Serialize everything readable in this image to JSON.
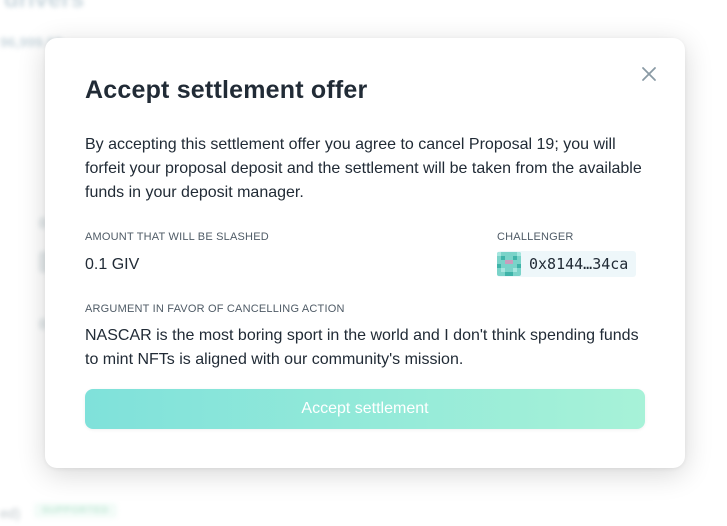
{
  "background": {
    "heading": "drivers",
    "subline_left": "96,999.99",
    "subline_right": "...",
    "status_text": "ed)",
    "status_badge": "SUPPORTED"
  },
  "modal": {
    "title": "Accept settlement offer",
    "description": "By accepting this settlement offer you agree to cancel Proposal 19; you will forfeit your proposal deposit and the settlement will be taken from the available funds in your deposit manager.",
    "amount_label": "AMOUNT THAT WILL BE SLASHED",
    "amount_value": "0.1 GIV",
    "challenger_label": "CHALLENGER",
    "challenger_address": "0x8144…34ca",
    "argument_label": "ARGUMENT IN FAVOR OF CANCELLING ACTION",
    "argument_text": "NASCAR is the most boring sport in the world and I don't think spending funds to mint NFTs is aligned with our community's mission.",
    "accept_button": "Accept settlement",
    "close_icon": "close-icon"
  },
  "colors": {
    "accent_start": "#7fe1da",
    "accent_end": "#a7f2d8",
    "text_primary": "#212b36",
    "label": "#4f5b66"
  }
}
